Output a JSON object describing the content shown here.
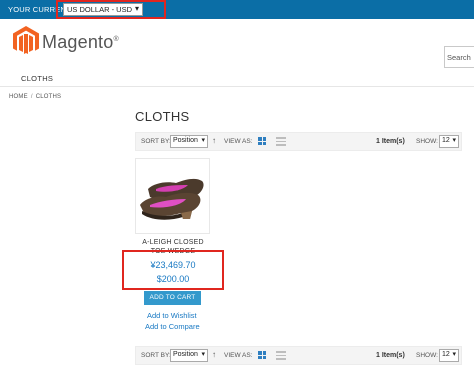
{
  "header": {
    "currency_label": "YOUR CURRENCY:",
    "currency_value": "US DOLLAR - USD",
    "logo_text": "Magento",
    "logo_mark": "®",
    "search_label": "Search",
    "brand_color": "#f26322",
    "topbar_color": "#0b6ea6"
  },
  "nav": {
    "items": [
      "CLOTHS"
    ]
  },
  "breadcrumb": {
    "home": "HOME",
    "separator": "/",
    "current": "CLOTHS"
  },
  "page": {
    "title": "CLOTHS"
  },
  "toolbar": {
    "sort_label": "SORT BY:",
    "sort_value": "Position",
    "direction_icon": "arrow-up-icon",
    "view_label": "VIEW AS:",
    "count": "1 Item(s)",
    "show_label": "SHOW:",
    "show_value": "12"
  },
  "product": {
    "name": "A-LEIGH CLOSED TOE WEDGE",
    "price_primary": "¥23,469.70",
    "price_secondary": "$200.00",
    "cart_label": "ADD TO CART",
    "wishlist_label": "Add to Wishlist",
    "compare_label": "Add to Compare"
  },
  "highlight_color": "#e0261f",
  "accent_color": "#1979c3"
}
